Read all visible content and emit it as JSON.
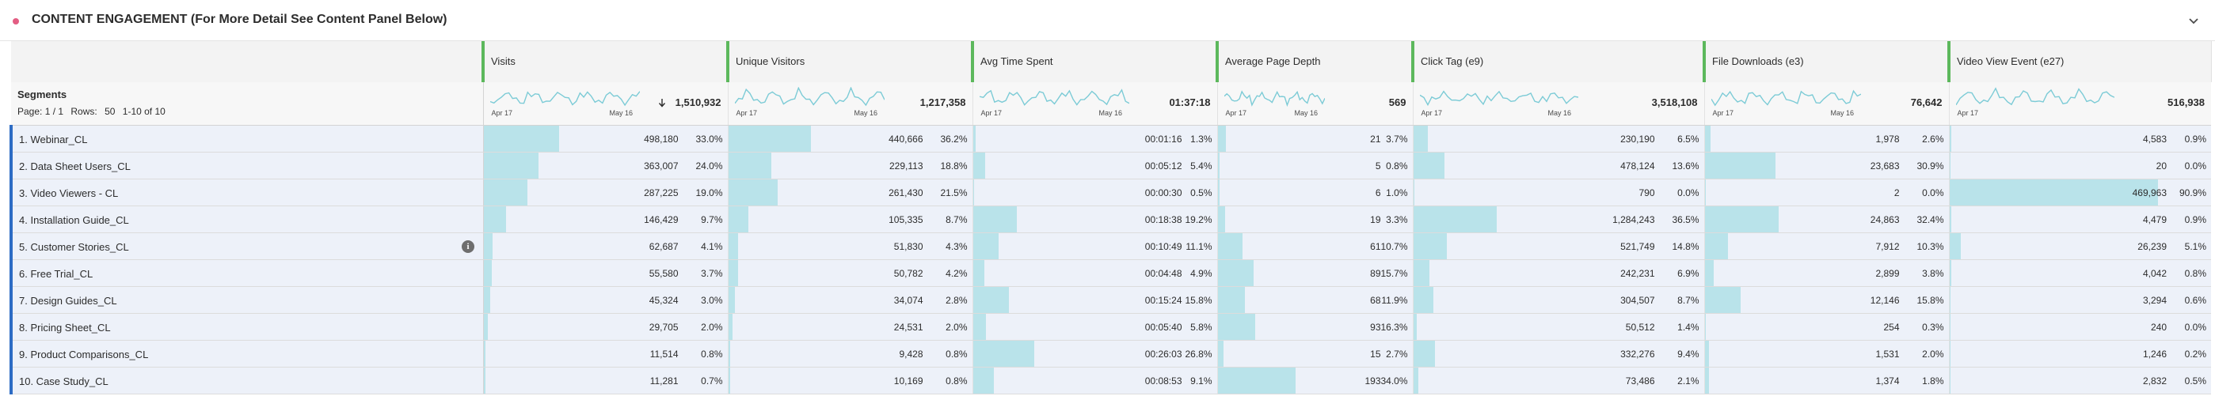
{
  "panel": {
    "title": "CONTENT ENGAGEMENT (For More Detail See Content Panel Below)",
    "dot_color": "#e35d83",
    "collapse_icon": "chevron-down-icon"
  },
  "segments": {
    "title": "Segments",
    "pager_page": "Page: 1 / 1",
    "pager_rows_label": "Rows:",
    "pager_rows_value": "50",
    "pager_range": "1-10 of 10",
    "items": [
      {
        "label": "1.  Webinar_CL"
      },
      {
        "label": "2.  Data Sheet Users_CL"
      },
      {
        "label": "3.  Video Viewers - CL"
      },
      {
        "label": "4.  Installation Guide_CL"
      },
      {
        "label": "5.  Customer Stories_CL",
        "info": true
      },
      {
        "label": "6.  Free Trial_CL"
      },
      {
        "label": "7.  Design Guides_CL"
      },
      {
        "label": "8.  Pricing Sheet_CL"
      },
      {
        "label": "9.  Product Comparisons_CL"
      },
      {
        "label": "10.  Case Study_CL"
      }
    ]
  },
  "metrics": [
    {
      "name": "Visits",
      "total": "1,510,932",
      "sorted": true,
      "spark_start": "Apr 17",
      "spark_end": "May 16",
      "values": [
        "498,180",
        "363,007",
        "287,225",
        "146,429",
        "62,687",
        "55,580",
        "45,324",
        "29,705",
        "11,514",
        "11,281"
      ],
      "pcts": [
        "33.0%",
        "24.0%",
        "19.0%",
        "9.7%",
        "4.1%",
        "3.7%",
        "3.0%",
        "2.0%",
        "0.8%",
        "0.7%"
      ],
      "shares": [
        0.33,
        0.24,
        0.19,
        0.097,
        0.041,
        0.037,
        0.03,
        0.02,
        0.008,
        0.007
      ]
    },
    {
      "name": "Unique Visitors",
      "total": "1,217,358",
      "spark_start": "Apr 17",
      "spark_end": "May 16",
      "values": [
        "440,666",
        "229,113",
        "261,430",
        "105,335",
        "51,830",
        "50,782",
        "34,074",
        "24,531",
        "9,428",
        "10,169"
      ],
      "pcts": [
        "36.2%",
        "18.8%",
        "21.5%",
        "8.7%",
        "4.3%",
        "4.2%",
        "2.8%",
        "2.0%",
        "0.8%",
        "0.8%"
      ],
      "shares": [
        0.362,
        0.188,
        0.215,
        0.087,
        0.043,
        0.042,
        0.028,
        0.02,
        0.008,
        0.008
      ]
    },
    {
      "name": "Avg Time Spent",
      "total": "01:37:18",
      "spark_start": "Apr 17",
      "spark_end": "May 16",
      "values": [
        "00:01:16",
        "00:05:12",
        "00:00:30",
        "00:18:38",
        "00:10:49",
        "00:04:48",
        "00:15:24",
        "00:05:40",
        "00:26:03",
        "00:08:53"
      ],
      "pcts": [
        "1.3%",
        "5.4%",
        "0.5%",
        "19.2%",
        "11.1%",
        "4.9%",
        "15.8%",
        "5.8%",
        "26.8%",
        "9.1%"
      ],
      "shares": [
        0.013,
        0.054,
        0.005,
        0.192,
        0.111,
        0.049,
        0.158,
        0.058,
        0.268,
        0.091
      ]
    },
    {
      "name": "Average Page Depth",
      "total": "569",
      "spark_start": "Apr 17",
      "spark_end": "May 16",
      "values": [
        "21",
        "5",
        "6",
        "19",
        "61",
        "89",
        "68",
        "93",
        "15",
        "193"
      ],
      "pcts": [
        "3.7%",
        "0.8%",
        "1.0%",
        "3.3%",
        "10.7%",
        "15.7%",
        "11.9%",
        "16.3%",
        "2.7%",
        "34.0%"
      ],
      "shares": [
        0.037,
        0.008,
        0.01,
        0.033,
        0.107,
        0.157,
        0.119,
        0.163,
        0.027,
        0.34
      ]
    },
    {
      "name": "Click Tag (e9)",
      "total": "3,518,108",
      "spark_start": "Apr 17",
      "spark_end": "May 16",
      "values": [
        "230,190",
        "478,124",
        "790",
        "1,284,243",
        "521,749",
        "242,231",
        "304,507",
        "50,512",
        "332,276",
        "73,486"
      ],
      "pcts": [
        "6.5%",
        "13.6%",
        "0.0%",
        "36.5%",
        "14.8%",
        "6.9%",
        "8.7%",
        "1.4%",
        "9.4%",
        "2.1%"
      ],
      "shares": [
        0.065,
        0.136,
        0.0,
        0.365,
        0.148,
        0.069,
        0.087,
        0.014,
        0.094,
        0.021
      ]
    },
    {
      "name": "File Downloads (e3)",
      "total": "76,642",
      "spark_start": "Apr 17",
      "spark_end": "May 16",
      "values": [
        "1,978",
        "23,683",
        "2",
        "24,863",
        "7,912",
        "2,899",
        "12,146",
        "254",
        "1,531",
        "1,374"
      ],
      "pcts": [
        "2.6%",
        "30.9%",
        "0.0%",
        "32.4%",
        "10.3%",
        "3.8%",
        "15.8%",
        "0.3%",
        "2.0%",
        "1.8%"
      ],
      "shares": [
        0.026,
        0.309,
        0.0,
        0.324,
        0.103,
        0.038,
        0.158,
        0.003,
        0.02,
        0.018
      ]
    },
    {
      "name": "Video View Event (e27)",
      "total": "516,938",
      "spark_start": "Apr 17",
      "spark_end": "",
      "values": [
        "4,583",
        "20",
        "469,963",
        "4,479",
        "26,239",
        "4,042",
        "3,294",
        "240",
        "1,246",
        "2,832"
      ],
      "pcts": [
        "0.9%",
        "0.0%",
        "90.9%",
        "0.9%",
        "5.1%",
        "0.8%",
        "0.6%",
        "0.0%",
        "0.2%",
        "0.5%"
      ],
      "shares": [
        0.009,
        0.0,
        0.909,
        0.009,
        0.051,
        0.008,
        0.006,
        0.0,
        0.002,
        0.005
      ]
    }
  ],
  "colors": {
    "accent_green": "#5cb85c",
    "bar": "#b9e3ea",
    "row_marker": "#2d6cc4",
    "spark_line": "#7ccbd6"
  }
}
